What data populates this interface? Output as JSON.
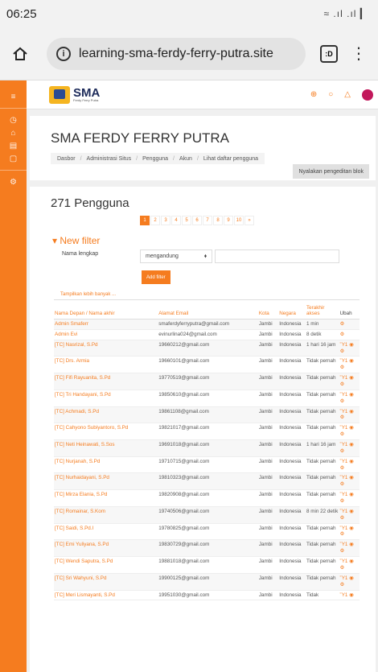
{
  "status": {
    "time": "06:25",
    "icons": "≈ .ıl .ıl ▎"
  },
  "browser": {
    "url": "learning-sma-ferdy-ferry-putra.site",
    "tab_label": ":D",
    "menu_glyph": "⋮"
  },
  "nav": {
    "logo_title": "SMA",
    "logo_sub": "Ferdy Ferry Putra",
    "globe_glyph": "⊕",
    "chat_glyph": "○",
    "bell_glyph": "△"
  },
  "rail": {
    "menu_glyph": "≡",
    "dashboard_glyph": "◷",
    "home_glyph": "⌂",
    "calendar_glyph": "▤",
    "files_glyph": "▢",
    "admin_glyph": "⚙"
  },
  "header": {
    "title": "SMA FERDY FERRY PUTRA",
    "breadcrumb": [
      "Dasbor",
      "Administrasi Situs",
      "Pengguna",
      "Akun",
      "Lihat daftar pengguna"
    ],
    "edit_button": "Nyalakan pengeditan blok"
  },
  "users": {
    "count_label": "271 Pengguna",
    "pages": [
      "1",
      "2",
      "3",
      "4",
      "5",
      "6",
      "7",
      "8",
      "9",
      "10",
      "»"
    ],
    "current_page": "1"
  },
  "filter": {
    "heading": "▾ New filter",
    "field_label": "Nama lengkap",
    "operator": "mengandung",
    "operator_caret": "⬧",
    "add_button": "Add filter",
    "show_more": "Tampilkan lebih banyak ..."
  },
  "table": {
    "headers": {
      "name": "Nama Depan / Nama akhir",
      "email": "Alamat Email",
      "city": "Kota",
      "country": "Negara",
      "access": "Terakhir akses",
      "edit": "Ubah"
    },
    "rows": [
      {
        "name": "Admin Smaferr",
        "email": "smaferdyferryputra@gmail.com",
        "city": "Jambi",
        "country": "Indonesia",
        "access": "1 min",
        "actions": "⚙"
      },
      {
        "name": "Admin Evi",
        "email": "evinurlina024@gmail.com",
        "city": "Jambi",
        "country": "Indonesia",
        "access": "8 detik",
        "actions": "⚙"
      },
      {
        "name": "[TC] Nasrizal, S.Pd",
        "email": "19660212@gmail.com",
        "city": "Jambi",
        "country": "Indonesia",
        "access": "1 hari 16 jam",
        "actions": "Ὕ1 ◉ ⚙"
      },
      {
        "name": "[TC] Drs. Armia",
        "email": "19660101@gmail.com",
        "city": "Jambi",
        "country": "Indonesia",
        "access": "Tidak pernah",
        "actions": "Ὕ1 ◉ ⚙"
      },
      {
        "name": "[TC] Fifi Rayuanita, S.Pd",
        "email": "19770519@gmail.com",
        "city": "Jambi",
        "country": "Indonesia",
        "access": "Tidak pernah",
        "actions": "Ὕ1 ◉ ⚙"
      },
      {
        "name": "[TC] Tri Handayani, S.Pd",
        "email": "19850610@gmail.com",
        "city": "Jambi",
        "country": "Indonesia",
        "access": "Tidak pernah",
        "actions": "Ὕ1 ◉ ⚙"
      },
      {
        "name": "[TC] Achmadi, S.Pd",
        "email": "19861108@gmail.com",
        "city": "Jambi",
        "country": "Indonesia",
        "access": "Tidak pernah",
        "actions": "Ὕ1 ◉ ⚙"
      },
      {
        "name": "[TC] Cahyono Subiyantoro, S.Pd",
        "email": "19821017@gmail.com",
        "city": "Jambi",
        "country": "Indonesia",
        "access": "Tidak pernah",
        "actions": "Ὕ1 ◉ ⚙"
      },
      {
        "name": "[TC] Neti Heinawati, S.Sos",
        "email": "19691018@gmail.com",
        "city": "Jambi",
        "country": "Indonesia",
        "access": "1 hari 16 jam",
        "actions": "Ὕ1 ◉ ⚙"
      },
      {
        "name": "[TC] Nurjanah, S.Pd",
        "email": "19710715@gmail.com",
        "city": "Jambi",
        "country": "Indonesia",
        "access": "Tidak pernah",
        "actions": "Ὕ1 ◉ ⚙"
      },
      {
        "name": "[TC] Nurhaidayani, S.Pd",
        "email": "19810323@gmail.com",
        "city": "Jambi",
        "country": "Indonesia",
        "access": "Tidak pernah",
        "actions": "Ὕ1 ◉ ⚙"
      },
      {
        "name": "[TC] Mirza Elania, S.Pd",
        "email": "19820908@gmail.com",
        "city": "Jambi",
        "country": "Indonesia",
        "access": "Tidak pernah",
        "actions": "Ὕ1 ◉ ⚙"
      },
      {
        "name": "[TC] Romainar, S.Kom",
        "email": "19740506@gmail.com",
        "city": "Jambi",
        "country": "Indonesia",
        "access": "8 min 22 detik",
        "actions": "Ὕ1 ◉ ⚙"
      },
      {
        "name": "[TC] Saidi, S.Pd.I",
        "email": "19780825@gmail.com",
        "city": "Jambi",
        "country": "Indonesia",
        "access": "Tidak pernah",
        "actions": "Ὕ1 ◉ ⚙"
      },
      {
        "name": "[TC] Emi Yuliyana, S.Pd",
        "email": "19830729@gmail.com",
        "city": "Jambi",
        "country": "Indonesia",
        "access": "Tidak pernah",
        "actions": "Ὕ1 ◉ ⚙"
      },
      {
        "name": "[TC] Wendi Saputra, S.Pd",
        "email": "19881018@gmail.com",
        "city": "Jambi",
        "country": "Indonesia",
        "access": "Tidak pernah",
        "actions": "Ὕ1 ◉ ⚙"
      },
      {
        "name": "[TC] Sri Wahyuni, S.Pd",
        "email": "19900125@gmail.com",
        "city": "Jambi",
        "country": "Indonesia",
        "access": "Tidak pernah",
        "actions": "Ὕ1 ◉ ⚙"
      },
      {
        "name": "[TC] Meri Lismayanti, S.Pd",
        "email": "19951030@gmail.com",
        "city": "Jambi",
        "country": "Indonesia",
        "access": "Tidak",
        "actions": "Ὕ1 ◉"
      }
    ]
  },
  "colors": {
    "accent": "#f57c1f",
    "brand_navy": "#1d2b5a"
  }
}
